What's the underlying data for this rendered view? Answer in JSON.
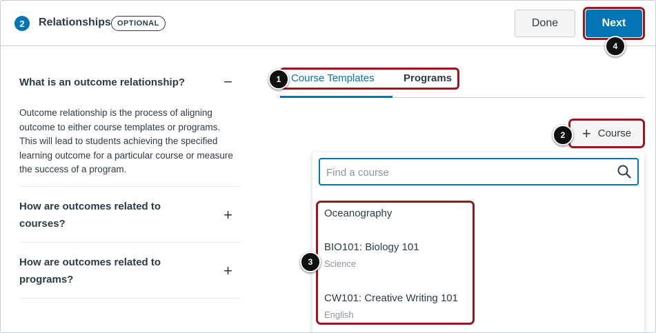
{
  "header": {
    "step_number": "2",
    "title": "Relationships",
    "badge": "OPTIONAL",
    "done_label": "Done",
    "next_label": "Next"
  },
  "faq": [
    {
      "question": "What is an outcome relationship?",
      "toggle": "−",
      "expanded": true,
      "answer": "Outcome relationship is the process of aligning outcome to either course templates or programs. This will lead to students achieving the specified learning outcome for a particular course or measure the success of a program."
    },
    {
      "question": "How are outcomes related to courses?",
      "toggle": "+",
      "expanded": false
    },
    {
      "question": "How are outcomes related to programs?",
      "toggle": "+",
      "expanded": false
    }
  ],
  "tabs": [
    {
      "label": "Course Templates",
      "active": true
    },
    {
      "label": "Programs",
      "active": false
    }
  ],
  "add_course": {
    "icon": "+",
    "label": "Course"
  },
  "search": {
    "placeholder": "Find a course",
    "value": ""
  },
  "courses": [
    {
      "name": "Oceanography",
      "subject": ""
    },
    {
      "name": "BIO101: Biology 101",
      "subject": "Science"
    },
    {
      "name": "CW101: Creative Writing 101",
      "subject": "English"
    }
  ],
  "callouts": [
    "1",
    "2",
    "3",
    "4"
  ],
  "colors": {
    "accent": "#0374b5",
    "highlight": "#a0151d",
    "text": "#2d3b45",
    "muted": "#8b969e"
  }
}
